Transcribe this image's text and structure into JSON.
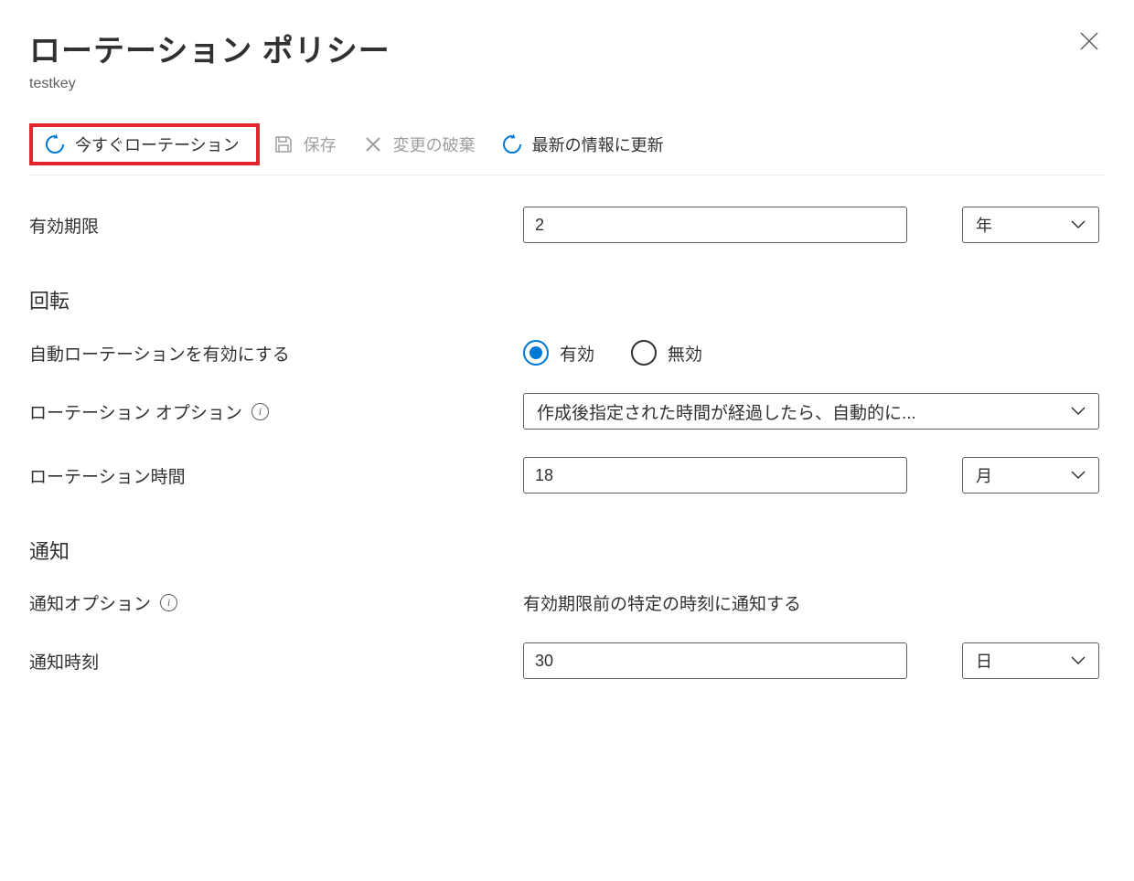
{
  "header": {
    "title": "ローテーション ポリシー",
    "subtitle": "testkey"
  },
  "toolbar": {
    "rotate_now": "今すぐローテーション",
    "save": "保存",
    "discard": "変更の破棄",
    "refresh": "最新の情報に更新"
  },
  "form": {
    "expiry_label": "有効期限",
    "expiry_value": "2",
    "expiry_unit": "年",
    "rotation_section": "回転",
    "auto_rotation_label": "自動ローテーションを有効にする",
    "radio_enabled": "有効",
    "radio_disabled": "無効",
    "rotation_option_label": "ローテーション オプション",
    "rotation_option_value": "作成後指定された時間が経過したら、自動的に...",
    "rotation_time_label": "ローテーション時間",
    "rotation_time_value": "18",
    "rotation_time_unit": "月",
    "notification_section": "通知",
    "notification_option_label": "通知オプション",
    "notification_option_value": "有効期限前の特定の時刻に通知する",
    "notification_time_label": "通知時刻",
    "notification_time_value": "30",
    "notification_time_unit": "日"
  }
}
